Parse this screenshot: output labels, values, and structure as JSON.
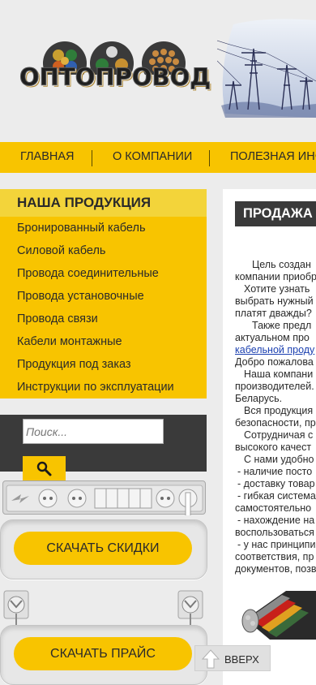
{
  "header": {
    "logo_text": "ОПТОПРОВОД"
  },
  "nav": {
    "items": [
      "Главная",
      "О компании",
      "Полезная инф"
    ]
  },
  "sidebar": {
    "title": "Наша продукция",
    "items": [
      "Бронированный кабель",
      "Силовой кабель",
      "Провода соединительные",
      "Провода установочные",
      "Провода связи",
      "Кабели монтажные",
      "Продукция под заказ",
      "Инструкции по эксплуатации"
    ]
  },
  "search": {
    "placeholder": "Поиск..."
  },
  "downloads": {
    "discounts_label": "Скачать скидки",
    "price_label": "Скачать прайс"
  },
  "content": {
    "title": "Продажа",
    "lines": [
      "Цель создан",
      "компании приобр",
      "Хотите узнать",
      "выбрать нужный",
      "платят дважды?",
      "Также предл",
      "актуальном про",
      "кабельной проду",
      "Добро пожалова",
      "Наша компани",
      "производителей.",
      "Беларусь.",
      "Вся продукция",
      "безопасности, пр",
      "Сотрудничая с",
      "высокого качест",
      "С нами удобно",
      "- наличие посто",
      "- доставку товар",
      "- гибкая система",
      "самостоятельно",
      "- нахождение на",
      "воспользоваться",
      "- у нас принципи",
      "соответствия, пр",
      "документов, позв"
    ]
  },
  "to_top": {
    "label": "Вверх"
  },
  "colors": {
    "accent": "#f8c400",
    "dark": "#3a3a3a",
    "link": "#1a3fb0"
  }
}
